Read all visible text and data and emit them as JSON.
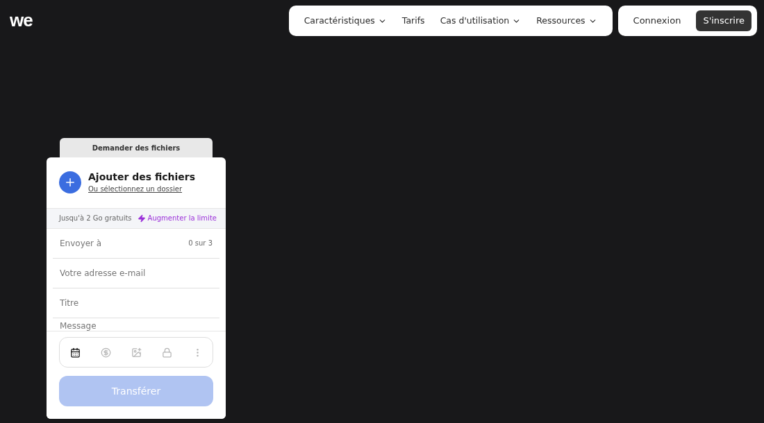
{
  "logo": "we",
  "nav": {
    "items": [
      {
        "label": "Caractéristiques",
        "dropdown": true
      },
      {
        "label": "Tarifs",
        "dropdown": false
      },
      {
        "label": "Cas d'utilisation",
        "dropdown": true
      },
      {
        "label": "Ressources",
        "dropdown": true
      }
    ],
    "login": "Connexion",
    "signup": "S'inscrire"
  },
  "panel": {
    "tab": "Demander des fichiers",
    "add_title": "Ajouter des fichiers",
    "add_link": "Ou sélectionnez un dossier",
    "limit": "Jusqu'à 2 Go gratuits",
    "upgrade": "Augmenter la limite",
    "fields": [
      {
        "placeholder": "Envoyer à",
        "counter": "0 sur 3"
      },
      {
        "placeholder": "Votre adresse e-mail"
      },
      {
        "placeholder": "Titre"
      },
      {
        "placeholder": "Message"
      }
    ],
    "tools": [
      {
        "kind": "calendar",
        "selected": true
      },
      {
        "kind": "dollar",
        "selected": false
      },
      {
        "kind": "image",
        "selected": false
      },
      {
        "kind": "lock",
        "selected": false
      },
      {
        "kind": "more",
        "selected": false
      }
    ],
    "submit": {
      "label": "Transférer",
      "disabled": true
    }
  }
}
